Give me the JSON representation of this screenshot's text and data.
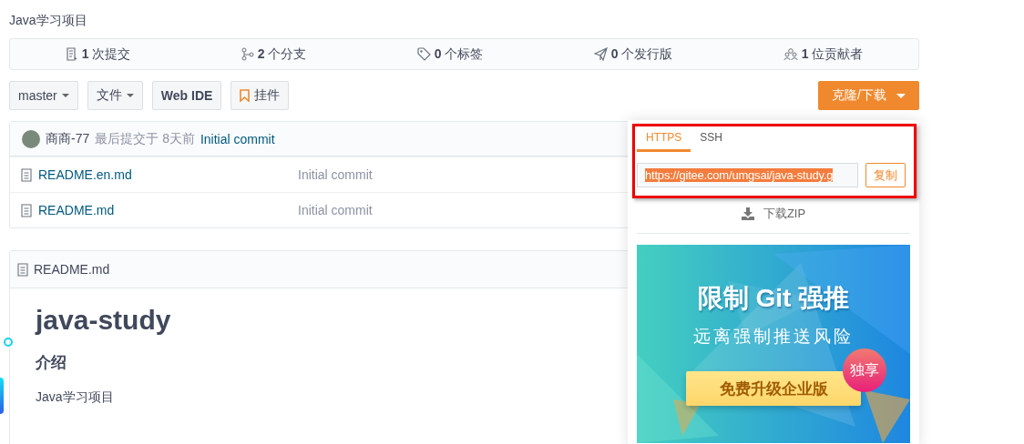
{
  "project_description": "Java学习项目",
  "stats": [
    {
      "kind": "commits",
      "count": "1",
      "label": "次提交"
    },
    {
      "kind": "branches",
      "count": "2",
      "label": "个分支"
    },
    {
      "kind": "tags",
      "count": "0",
      "label": "个标签"
    },
    {
      "kind": "releases",
      "count": "0",
      "label": "个发行版"
    },
    {
      "kind": "contributors",
      "count": "1",
      "label": "位贡献者"
    }
  ],
  "toolbar": {
    "branch": "master",
    "file_menu": "文件",
    "web_ide": "Web IDE",
    "widget": "挂件",
    "clone_button": "克隆/下载"
  },
  "last_commit": {
    "author": "商商-77",
    "info": "最后提交于",
    "time": "8天前",
    "message": "Initial commit"
  },
  "files": [
    {
      "name": "README.en.md",
      "commit": "Initial commit"
    },
    {
      "name": "README.md",
      "commit": "Initial commit"
    }
  ],
  "readme": {
    "filename": "README.md",
    "title": "java-study",
    "sections": [
      {
        "heading": "介绍",
        "text": "Java学习项目"
      }
    ]
  },
  "clone_popup": {
    "tabs": [
      {
        "label": "HTTPS",
        "selected": true
      },
      {
        "label": "SSH",
        "selected": false
      }
    ],
    "url": "https://gitee.com/umgsai/java-study.g",
    "copy": "复制",
    "download": "下载ZIP",
    "banner": {
      "title": "限制 Git 强推",
      "subtitle": "远离强制推送风险",
      "button": "免费升级企业版",
      "badge": "独享"
    }
  }
}
